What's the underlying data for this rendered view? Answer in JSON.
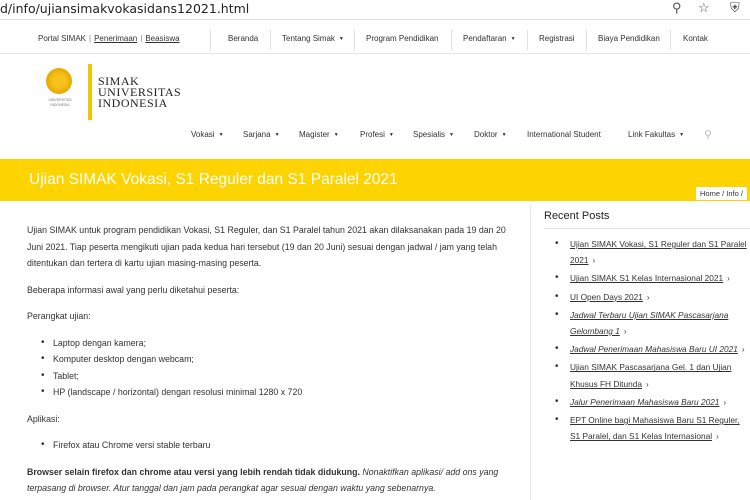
{
  "browser": {
    "url": "d/info/ujiansimakvokasidans12021.html",
    "icons": [
      "search-icon",
      "star-icon",
      "shield-icon"
    ]
  },
  "topnav": {
    "portal": "Portal SIMAK",
    "sep": "|",
    "penerimaan": "Penerimaan",
    "beasiswa": "Beasiswa",
    "items": [
      "Beranda",
      "Tentang Simak",
      "Program Pendidikan",
      "Pendaftaran",
      "Registrasi",
      "Biaya Pendidikan",
      "Kontak"
    ]
  },
  "logo": {
    "line1": "SIMAK",
    "line2": "UNIVERSITAS",
    "line3": "INDONESIA",
    "seal_caption": "UNIVERSITAS INDONESIA"
  },
  "mainnav": {
    "items": [
      "Vokasi",
      "Sarjana",
      "Magister",
      "Profesi",
      "Spesialis",
      "Doktor",
      "International Student",
      "Link Fakultas"
    ]
  },
  "page": {
    "title": "Ujian SIMAK Vokasi, S1 Reguler dan S1 Paralel 2021",
    "breadcrumb": "Home / Info /"
  },
  "content": {
    "intro": "Ujian SIMAK untuk program pendidikan Vokasi, S1 Reguler, dan S1 Paralel tahun 2021 akan dilaksanakan pada 19 dan 20 Juni 2021. Tiap peserta mengikuti ujian pada kedua hari tersebut (19 dan 20 Juni) sesuai dengan jadwal / jam yang telah ditentukan dan tertera di kartu ujian masing-masing peserta.",
    "info_heading": "Beberapa informasi awal yang perlu diketahui peserta:",
    "device_heading": "Perangkat ujian:",
    "devices": [
      "Laptop dengan kamera;",
      "Komputer desktop dengan webcam;",
      "Tablet;",
      "HP (landscape / horizontal) dengan resolusi minimal 1280 x 720"
    ],
    "app_heading": "Aplikasi:",
    "apps": [
      "Firefox atau Chrome versi stable terbaru"
    ],
    "browser_note_bold": "Browser selain firefox dan chrome atau versi yang lebih rendah tidak didukung.",
    "browser_note_italic": " Nonaktifkan aplikasi/ add ons yang terpasang di browser. Atur tanggal dan jam pada perangkat agar sesuai dengan waktu yang sebenarnya."
  },
  "sidebar": {
    "title": "Recent Posts",
    "posts": [
      "Ujian SIMAK Vokasi, S1 Reguler dan S1 Paralel 2021",
      "Ujian SIMAK S1 Kelas Internasional 2021",
      "UI Open Days 2021",
      "Jadwal Terbaru Ujian SIMAK Pascasarjana Gelombang 1",
      "Jadwal Penerimaan Mahasiswa Baru UI 2021",
      "Ujian SIMAK Pascasarjana Gel. 1 dan Ujian Khusus FH Ditunda",
      "Jalur Penerimaan Mahasiswa Baru 2021",
      "EPT Online bagi Mahasiswa Baru S1 Reguler, S1 Paralel, dan S1 Kelas Internasional"
    ],
    "arrow": "›"
  },
  "colors": {
    "banner": "#fed400",
    "logo_bar": "#f2c500"
  }
}
